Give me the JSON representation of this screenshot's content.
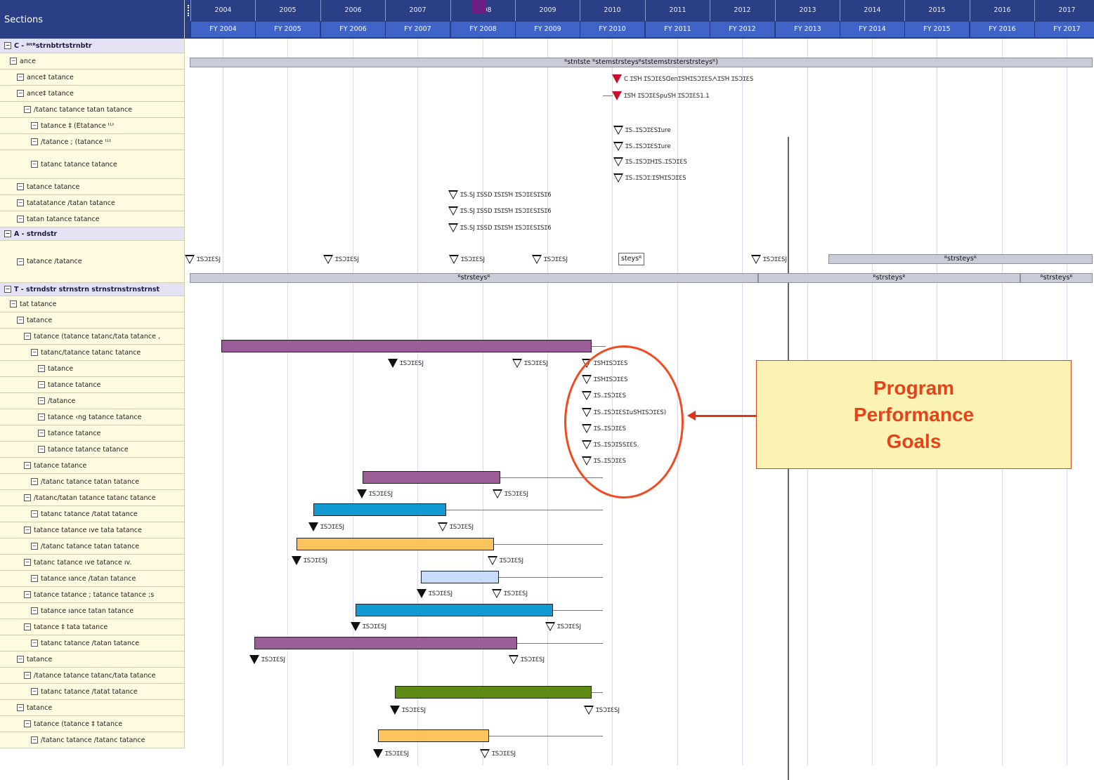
{
  "sections_header": "Sections",
  "years": [
    "2004",
    "2005",
    "2006",
    "2007",
    "2008",
    "2009",
    "2010",
    "2011",
    "2012",
    "2013",
    "2014",
    "2015",
    "2016",
    "2017"
  ],
  "fiscal_years": [
    "FY 2004",
    "FY 2005",
    "FY 2006",
    "FY 2007",
    "FY 2008",
    "FY 2009",
    "FY 2010",
    "FY 2011",
    "FY 2012",
    "FY 2013",
    "FY 2014",
    "FY 2015",
    "FY 2016",
    "FY 2017"
  ],
  "sections": [
    {
      "label": "C - ᴴᵗᴿstrnbtrtstrnbtr",
      "group": true
    },
    {
      "label": "ance"
    },
    {
      "label": "ance‡ tatance"
    },
    {
      "label": "ance‡ tatance"
    },
    {
      "label": "/tatanc tatance tatan tatance"
    },
    {
      "label": "tatance ‡ (Etatance ᵗᴸᵗ"
    },
    {
      "label": "/tatance ; (tatance ᵗᴸᵗ"
    },
    {
      "label": "tatanc tatance  tatance"
    },
    {
      "label": "tatance tatance"
    },
    {
      "label": "tatatatance /tatan tatance"
    },
    {
      "label": "tatan tatance tatance"
    },
    {
      "label": "A - strndstr",
      "group": true
    },
    {
      "label": "tatance /tatance"
    },
    {
      "label": "T -  strndstr strnstrn  strnstrnstrnstrnst",
      "group": true
    },
    {
      "label": "tat tatance"
    },
    {
      "label": "tatance"
    },
    {
      "label": "tatance (tatance tatanc/tata tatance ,"
    },
    {
      "label": "tatanc/tatance tatanc tatance"
    },
    {
      "label": "tatance"
    },
    {
      "label": "tatance  tatance"
    },
    {
      "label": "/tatance"
    },
    {
      "label": "tatance ‹ng tatance  tatance"
    },
    {
      "label": "tatance tatance"
    },
    {
      "label": "tatance  tatance tatance"
    },
    {
      "label": "tatance tatance"
    },
    {
      "label": "/tatanc tatance  tatan tatance"
    },
    {
      "label": "/tatanc/tatan tatance  tatanc tatance"
    },
    {
      "label": "tatanc tatance /tatat tatance"
    },
    {
      "label": "tatance tatance ıve  tata tatance"
    },
    {
      "label": "/tatanc tatance  tatan tatance"
    },
    {
      "label": "tatanc tatance ıve tatance ıv."
    },
    {
      "label": "tatance ıance  /tatan tatance"
    },
    {
      "label": "tatance  tatance ; tatance  tatance ;s"
    },
    {
      "label": "tatance ıance  tatan tatance"
    },
    {
      "label": "tatance ‡ tata tatance"
    },
    {
      "label": "tatanc tatance  /tatan tatance"
    },
    {
      "label": "tatance"
    },
    {
      "label": "/tatance  tatance  tatanc/tata tatance"
    },
    {
      "label": "tatanc tatance  /tatat tatance"
    },
    {
      "label": "tatance"
    },
    {
      "label": "tatance (tatance ‡  tatance"
    },
    {
      "label": "/tatanc tatance  /tatanc tatance"
    }
  ],
  "summary_bars": [
    {
      "label": "ᴿstntste  ᴿstemstrsteysᴿststemstrsterstrsteysᴿ)"
    },
    {
      "label": "ᴿstrsteysᴿ"
    },
    {
      "label": "ᴿstrsteysᴿ"
    },
    {
      "label": "ᴿstrsteysᴿ"
    },
    {
      "label": "ᴿstrsteysᴿ"
    }
  ],
  "boxed_label": "steysᴿ",
  "milestones": [
    {
      "text": "C ꞮSꞪ ꞮSƆꞮƐSᗡenꞮSꞪꞮSƆꞮƐSᗅꞮSꞪ ꞮSƆꞮƐS"
    },
    {
      "text": "ꞮSꞪ ꞮSƆꞮƐSpuSꞪ ꞮSƆꞮƐS1.1"
    },
    {
      "text": "ꞮS₌ꞮSƆꞮƐSꞮure"
    },
    {
      "text": "ꞮS₌ꞮSƆꞮƐSꞮure"
    },
    {
      "text": "ꞮS₌ꞮSƆꞮHꞮS₌ꞮSƆꞮƐS"
    },
    {
      "text": "ꞮS₌ꞮSƆꞮ꞉ꞮSꞪꞮSƆꞮƐS"
    },
    {
      "text": "ꞮS.SJ  ꞮSSD ꞮSꞮSꞪ  ꞮSƆꞮƐSꞮSꞮ6"
    },
    {
      "text": "ꞮS.SJ  ꞮSSD ꞮSꞮSꞪ  ꞮSƆꞮƐSꞮSꞮ6"
    },
    {
      "text": "ꞮS.SJ  ꞮSSD ꞮSꞮSꞪ  ꞮSƆꞮƐSꞮSꞮ6"
    },
    {
      "text": "ꞮSƆꞮƐSJ"
    },
    {
      "text": "ꞮSƆꞮƐSJ"
    },
    {
      "text": "ꞮSƆꞮƐSJ"
    },
    {
      "text": "ꞮSƆꞮƐSJ"
    },
    {
      "text": "ꞮSƆꞮƐSJ"
    },
    {
      "text": "ꞮSƆꞮƐSJ"
    },
    {
      "text": "ꞮSƆꞮƐSJ"
    },
    {
      "text": "ꞮSꞪꞮSƆꞮƐS"
    },
    {
      "text": "ꞮSꞪꞮSƆꞮƐS"
    },
    {
      "text": "ꞮS₌ꞮSƆꞮƐS"
    },
    {
      "text": "ꞮS₌ꞮSƆꞮƐSꞮuSꞪꞮSƆꞮƐS)"
    },
    {
      "text": "ꞮS₌ꞮSƆꞮƐS"
    },
    {
      "text": "ꞮS₌ꞮSƆꞮSSꞮƐS."
    },
    {
      "text": "ꞮS₌ꞮSƆꞮƐS"
    },
    {
      "text": "ꞮSƆꞮƐSJ"
    },
    {
      "text": "ꞮSƆꞮƐSJ"
    },
    {
      "text": "ꞮSƆꞮƐSJ"
    },
    {
      "text": "ꞮSƆꞮƐSJ"
    },
    {
      "text": "ꞮSƆꞮƐSJ"
    },
    {
      "text": "ꞮSƆꞮƐSJ"
    },
    {
      "text": "ꞮSƆꞮƐSJ"
    },
    {
      "text": "ꞮSƆꞮƐSJ"
    },
    {
      "text": "ꞮSƆꞮƐSJ"
    },
    {
      "text": "ꞮSƆꞮƐSJ"
    },
    {
      "text": "ꞮSƆꞮƐSJ"
    },
    {
      "text": "ꞮSƆꞮƐSJ"
    },
    {
      "text": "ꞮSƆꞮƐSJ"
    },
    {
      "text": "ꞮSƆꞮƐSJ"
    },
    {
      "text": "ꞮSƆꞮƐSJ"
    },
    {
      "text": "ꞮSƆꞮƐSJ"
    },
    {
      "text": "ꞮSƆꞮƐSJ"
    },
    {
      "text": "ꞮSƆꞮƐSJ"
    }
  ],
  "bar_colors": [
    "#9b5d97",
    "#9b5d97",
    "#149ad3",
    "#fbc45c",
    "#c7dbfb",
    "#149ad3",
    "#9b5d97",
    "#5c8c14",
    "#fbc45c"
  ],
  "callout": {
    "line1": "Program",
    "line2": "Performance",
    "line3": "Goals"
  },
  "accent_colors": {
    "header": "#2a3f86",
    "fy_cell": "#3f63c7",
    "callout_border": "#d04a20",
    "callout_text": "#e8421a",
    "callout_bg": "#fbf3b4"
  }
}
